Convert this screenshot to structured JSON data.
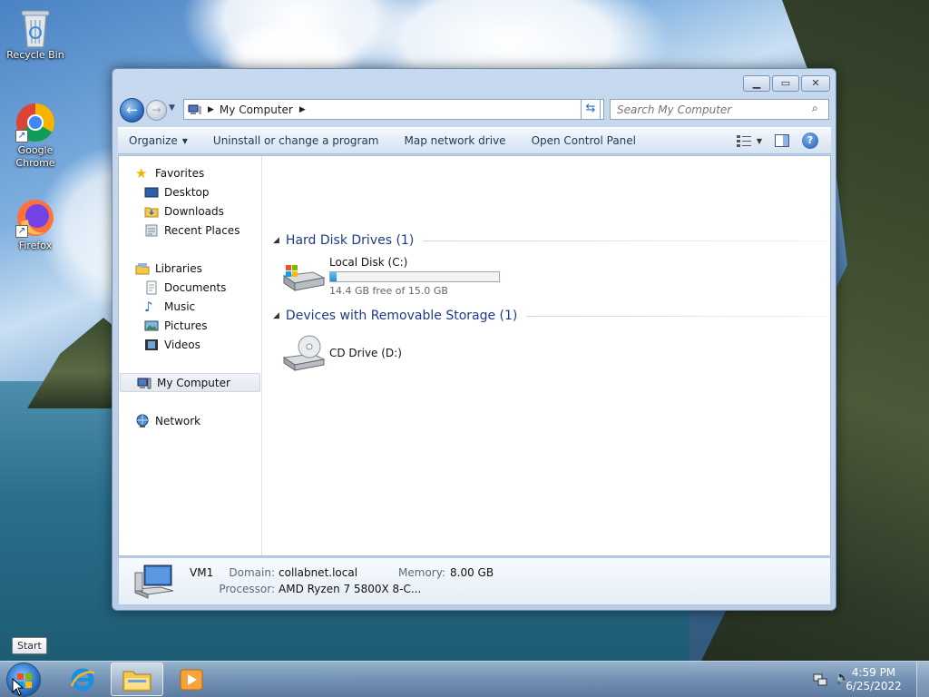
{
  "desktop": {
    "icons": [
      {
        "label": "Recycle Bin"
      },
      {
        "label": "Google Chrome"
      },
      {
        "label": "Firefox"
      }
    ]
  },
  "window": {
    "address": {
      "location": "My Computer"
    },
    "search": {
      "placeholder": "Search My Computer"
    },
    "toolbar": {
      "organize": "Organize",
      "uninstall": "Uninstall or change a program",
      "map_drive": "Map network drive",
      "control_panel": "Open Control Panel"
    },
    "nav": {
      "favorites": "Favorites",
      "desktop": "Desktop",
      "downloads": "Downloads",
      "recent": "Recent Places",
      "libraries": "Libraries",
      "documents": "Documents",
      "music": "Music",
      "pictures": "Pictures",
      "videos": "Videos",
      "computer": "My Computer",
      "network": "Network"
    },
    "groups": {
      "hdd": "Hard Disk Drives (1)",
      "removable": "Devices with Removable Storage (1)"
    },
    "drives": {
      "c": {
        "name": "Local Disk (C:)",
        "free": "14.4 GB free of 15.0 GB",
        "used_fraction": 0.04
      },
      "d": {
        "name": "CD Drive (D:)"
      }
    },
    "details": {
      "name": "VM1",
      "domain_label": "Domain:",
      "domain": "collabnet.local",
      "memory_label": "Memory:",
      "memory": "8.00 GB",
      "processor_label": "Processor:",
      "processor": "AMD Ryzen 7 5800X 8-C..."
    }
  },
  "taskbar": {
    "tooltip": "Start",
    "time": "4:59 PM",
    "date": "6/25/2022"
  }
}
